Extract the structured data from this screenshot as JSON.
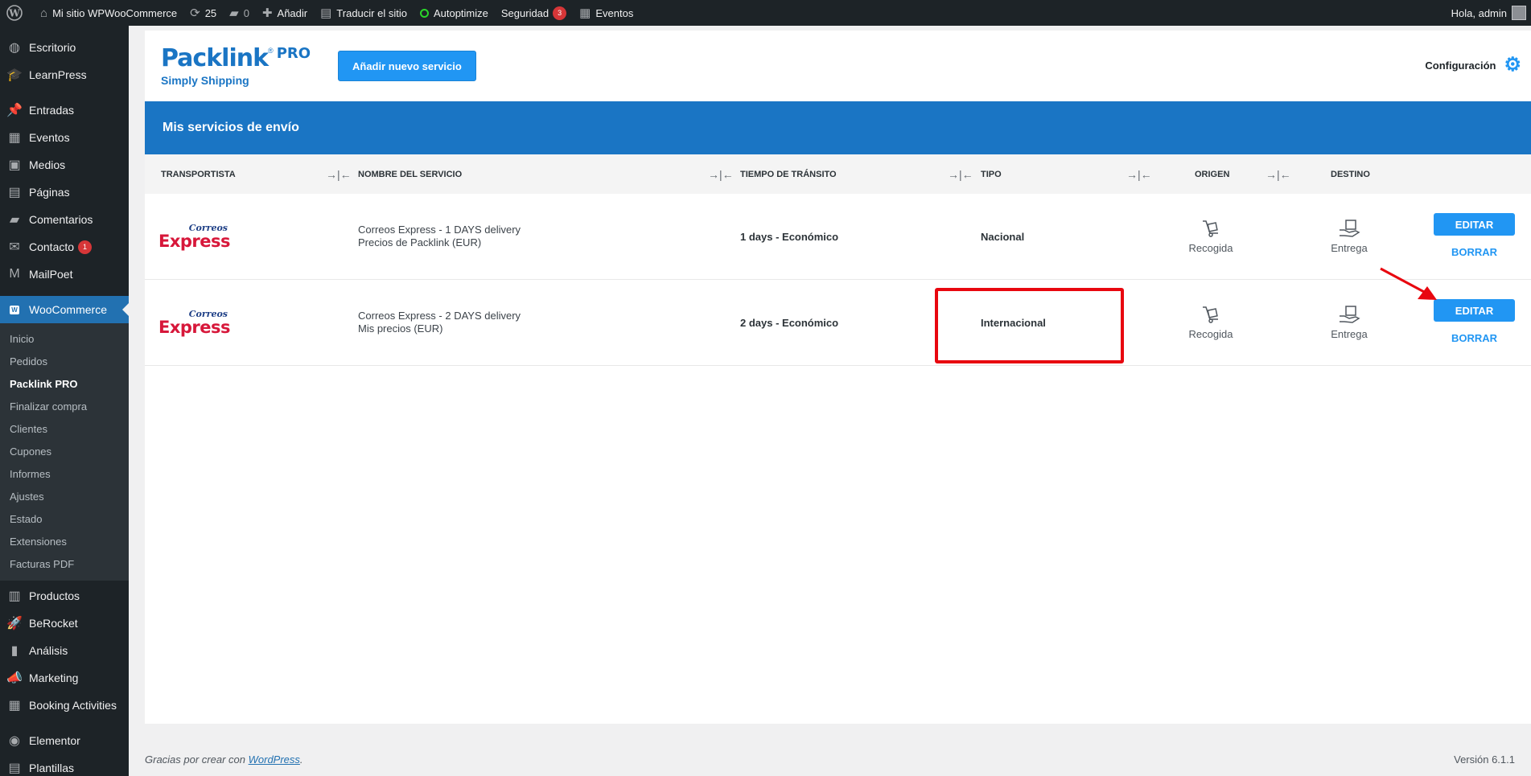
{
  "adminbar": {
    "site_name": "Mi sitio WPWooCommerce",
    "updates_count": "25",
    "comments_count": "0",
    "add_label": "Añadir",
    "translate_label": "Traducir el sitio",
    "autoptimize_label": "Autoptimize",
    "security_label": "Seguridad",
    "security_count": "3",
    "events_label": "Eventos",
    "greeting": "Hola, admin"
  },
  "sidebar": {
    "items_top": [
      {
        "label": "Escritorio",
        "icon": "dashboard-icon",
        "glyph": "◍"
      },
      {
        "label": "LearnPress",
        "icon": "graduation-cap-icon",
        "glyph": "🎓"
      }
    ],
    "items_mid": [
      {
        "label": "Entradas",
        "icon": "pin-icon",
        "glyph": "📌"
      },
      {
        "label": "Eventos",
        "icon": "calendar-icon",
        "glyph": "▦"
      },
      {
        "label": "Medios",
        "icon": "media-icon",
        "glyph": "▣"
      },
      {
        "label": "Páginas",
        "icon": "pages-icon",
        "glyph": "▤"
      },
      {
        "label": "Comentarios",
        "icon": "comment-icon",
        "glyph": "▰"
      },
      {
        "label": "Contacto",
        "icon": "mail-icon",
        "glyph": "✉",
        "badge": "1"
      },
      {
        "label": "MailPoet",
        "icon": "mailpoet-icon",
        "glyph": "M"
      }
    ],
    "woocommerce": {
      "label": "WooCommerce",
      "icon": "woo-icon",
      "glyph": "W"
    },
    "submenu": [
      "Inicio",
      "Pedidos",
      "Packlink PRO",
      "Finalizar compra",
      "Clientes",
      "Cupones",
      "Informes",
      "Ajustes",
      "Estado",
      "Extensiones",
      "Facturas PDF"
    ],
    "submenu_current": "Packlink PRO",
    "items_bottom": [
      {
        "label": "Productos",
        "icon": "archive-icon",
        "glyph": "▥"
      },
      {
        "label": "BeRocket",
        "icon": "rocket-icon",
        "glyph": "🚀"
      },
      {
        "label": "Análisis",
        "icon": "chart-icon",
        "glyph": "▮"
      },
      {
        "label": "Marketing",
        "icon": "megaphone-icon",
        "glyph": "📣"
      },
      {
        "label": "Booking Activities",
        "icon": "calendar-icon",
        "glyph": "▦"
      }
    ],
    "items_last": [
      {
        "label": "Elementor",
        "icon": "elementor-icon",
        "glyph": "◉"
      },
      {
        "label": "Plantillas",
        "icon": "templates-icon",
        "glyph": "▤"
      }
    ]
  },
  "header": {
    "logo_main": "Packlink",
    "logo_reg": "®",
    "logo_pro": "PRO",
    "logo_sub": "Simply Shipping",
    "add_service_label": "Añadir nuevo servicio",
    "config_label": "Configuración"
  },
  "section_title": "Mis servicios de envío",
  "table": {
    "headers": {
      "carrier": "TRANSPORTISTA",
      "service": "NOMBRE DEL SERVICIO",
      "transit": "TIEMPO DE TRÁNSITO",
      "type": "TIPO",
      "origin": "ORIGEN",
      "destination": "DESTINO"
    },
    "rows": [
      {
        "carrier_top": "Correos",
        "carrier_bottom": "Express",
        "service_line1": "Correos Express - 1 DAYS delivery",
        "service_line2": "Precios de Packlink (EUR)",
        "transit": "1 days - Económico",
        "type": "Nacional",
        "origin": "Recogida",
        "destination": "Entrega",
        "edit": "EDITAR",
        "delete": "BORRAR"
      },
      {
        "carrier_top": "Correos",
        "carrier_bottom": "Express",
        "service_line1": "Correos Express - 2 DAYS delivery",
        "service_line2": "Mis precios (EUR)",
        "transit": "2 days - Económico",
        "type": "Internacional",
        "origin": "Recogida",
        "destination": "Entrega",
        "edit": "EDITAR",
        "delete": "BORRAR"
      }
    ]
  },
  "footer": {
    "thanks_prefix": "Gracias por crear con ",
    "thanks_link": "WordPress",
    "thanks_suffix": ".",
    "version": "Versión 6.1.1"
  },
  "colors": {
    "brand_blue": "#1a75c4",
    "button_blue": "#2196f3",
    "highlight_red": "#e8070f",
    "admin_dark": "#1d2327",
    "wp_blue": "#2271b1"
  }
}
